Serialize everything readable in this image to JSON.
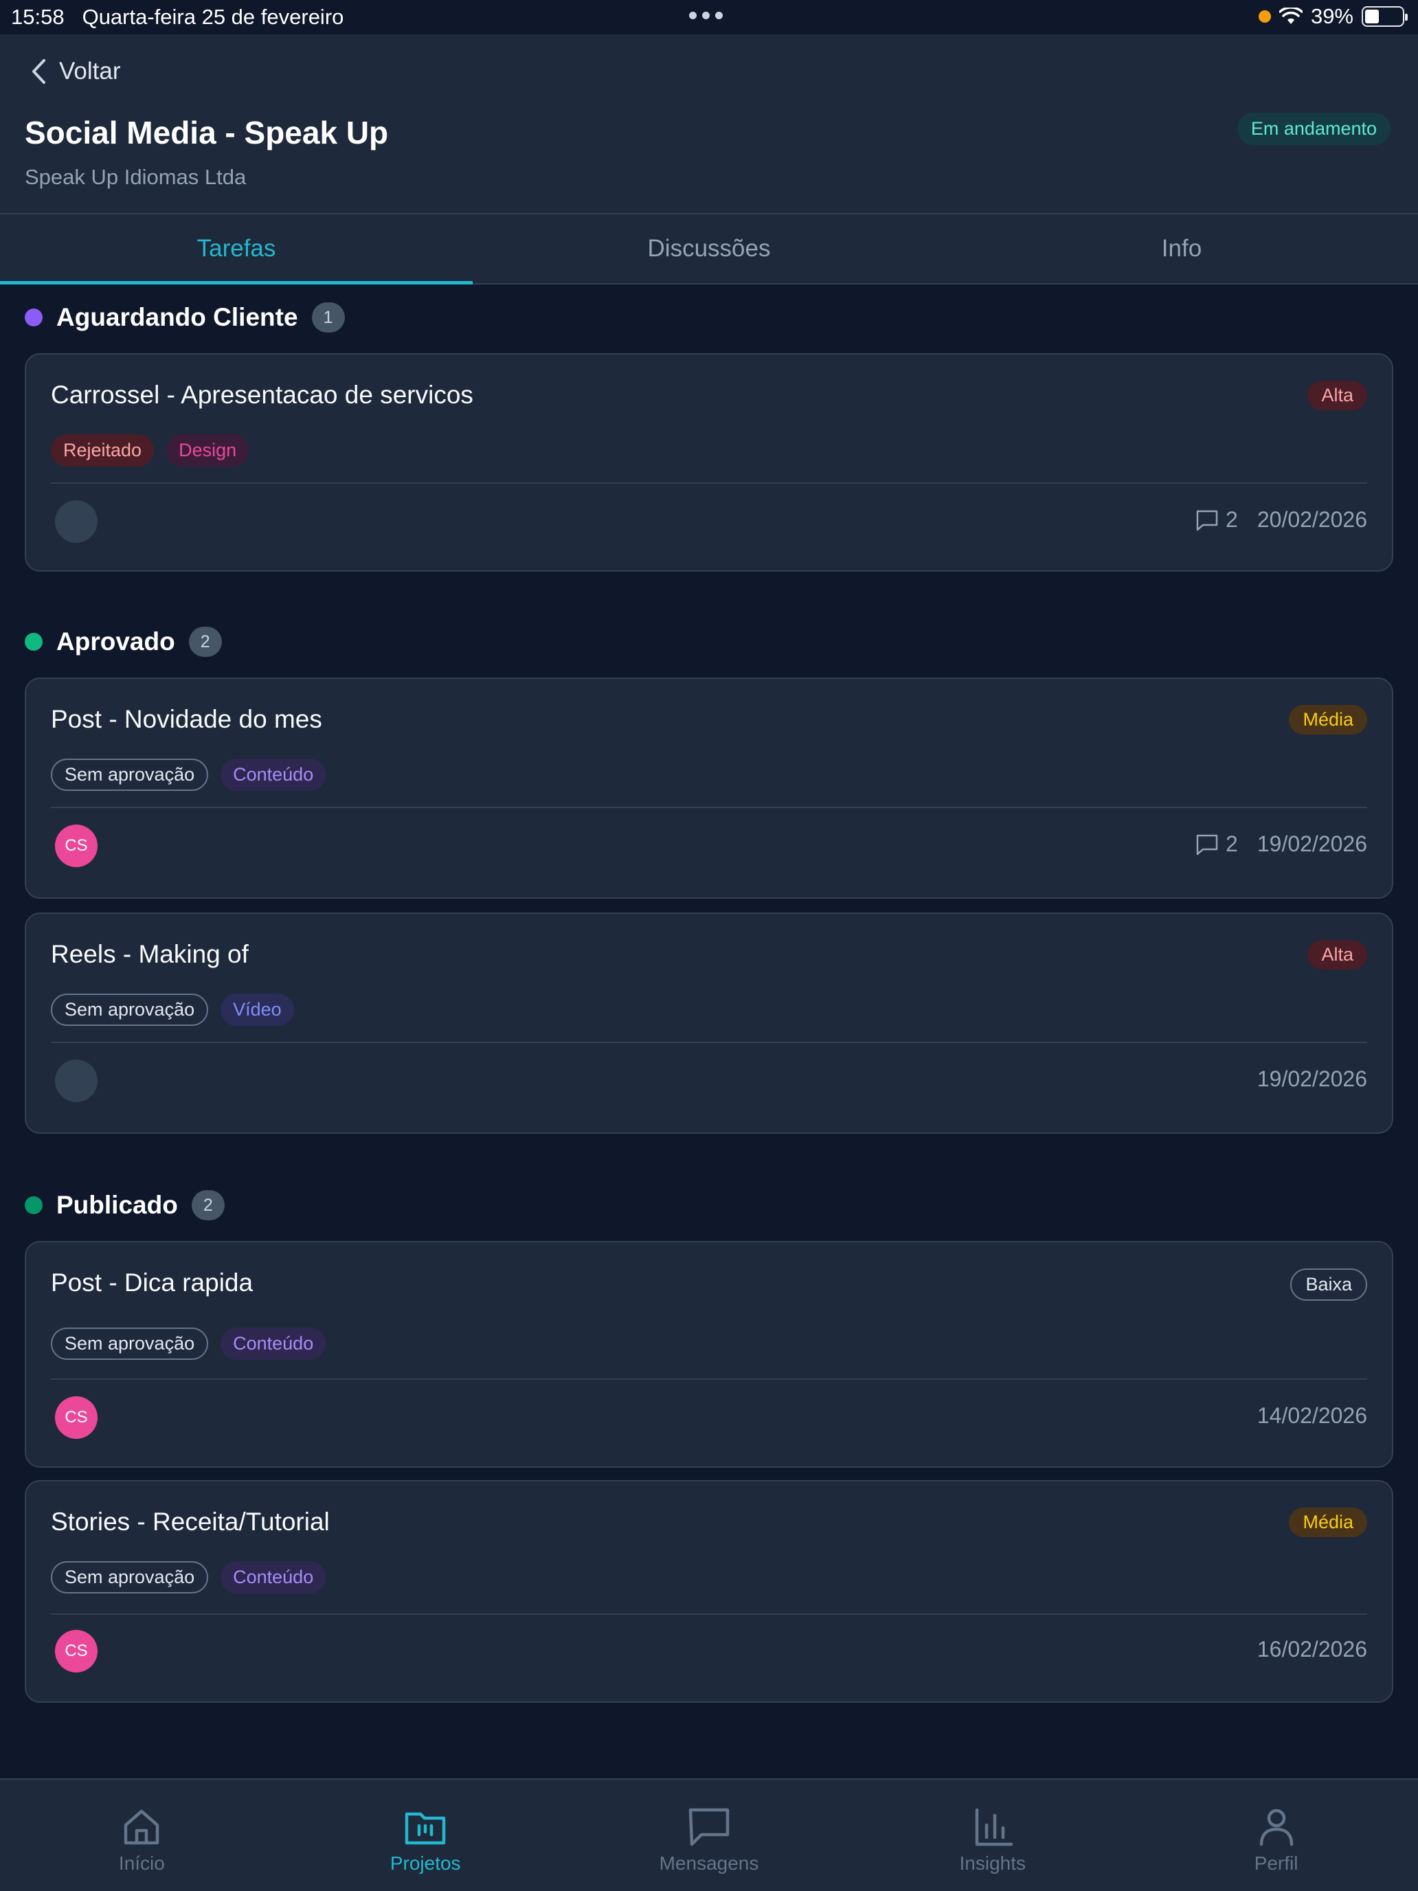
{
  "status_bar": {
    "time": "15:58",
    "date": "Quarta-feira 25 de fevereiro",
    "battery": "39%",
    "battery_level": 0.39
  },
  "header": {
    "back_label": "Voltar",
    "title": "Social Media - Speak Up",
    "subtitle": "Speak Up Idiomas Ltda",
    "status": "Em andamento"
  },
  "tabs": [
    {
      "label": "Tarefas",
      "active": true
    },
    {
      "label": "Discussões",
      "active": false
    },
    {
      "label": "Info",
      "active": false
    }
  ],
  "groups": [
    {
      "title": "Aguardando Cliente",
      "count": "1",
      "dot_color": "#8b5cf6",
      "cards": [
        {
          "title": "Carrossel - Apresentacao de servicos",
          "priority": "Alta",
          "tags": [
            "Rejeitado",
            "Design"
          ],
          "avatar": "",
          "comments": "2",
          "date": "20/02/2026"
        }
      ]
    },
    {
      "title": "Aprovado",
      "count": "2",
      "dot_color": "#10b981",
      "cards": [
        {
          "title": "Post - Novidade do mes",
          "priority": "Média",
          "tags": [
            "Sem aprovação",
            "Conteúdo"
          ],
          "avatar": "CS",
          "comments": "2",
          "date": "19/02/2026"
        },
        {
          "title": "Reels - Making of",
          "priority": "Alta",
          "tags": [
            "Sem aprovação",
            "Vídeo"
          ],
          "avatar": "",
          "comments": "",
          "date": "19/02/2026"
        }
      ]
    },
    {
      "title": "Publicado",
      "count": "2",
      "dot_color": "#059669",
      "cards": [
        {
          "title": "Post - Dica rapida",
          "priority": "Baixa",
          "tags": [
            "Sem aprovação",
            "Conteúdo"
          ],
          "avatar": "CS",
          "comments": "",
          "date": "14/02/2026"
        },
        {
          "title": "Stories - Receita/Tutorial",
          "priority": "Média",
          "tags": [
            "Sem aprovação",
            "Conteúdo"
          ],
          "avatar": "CS",
          "comments": "",
          "date": "16/02/2026"
        }
      ]
    }
  ],
  "nav": [
    {
      "label": "Início",
      "icon": "home-icon"
    },
    {
      "label": "Projetos",
      "icon": "folder-icon",
      "active": true
    },
    {
      "label": "Mensagens",
      "icon": "message-icon"
    },
    {
      "label": "Insights",
      "icon": "chart-icon"
    },
    {
      "label": "Perfil",
      "icon": "user-icon"
    }
  ],
  "colors": {
    "accent": "#22b8cf",
    "background": "#0f172a",
    "card": "#1e293b"
  }
}
